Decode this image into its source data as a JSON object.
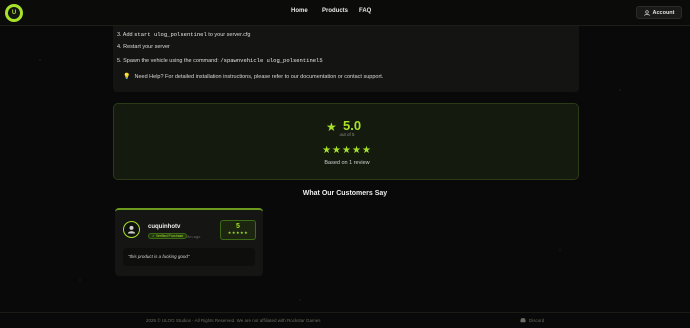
{
  "brand": {
    "logo_text": "U"
  },
  "nav": {
    "items": [
      "Home",
      "Products",
      "FAQ"
    ]
  },
  "account": {
    "label": "Account",
    "icon": "user-icon"
  },
  "install": {
    "step3_prefix": "3. Add",
    "step3_code": "start ulog_polsentinel",
    "step3_suffix": "to your server.cfg",
    "step4": "4. Restart your server",
    "step5_prefix": "5. Spawn the vehicle using the command:",
    "step5_code": "/spawnvehicle ulog_polsentinel5",
    "help_text": "Need Help? For detailed installation instructions, please refer to our documentation or contact support."
  },
  "rating": {
    "score": "5.0",
    "out_of": "out of 5",
    "stars": "★★★★★",
    "based_on": "Based on 1 review"
  },
  "reviews": {
    "title": "What Our Customers Say",
    "items": [
      {
        "username": "cuquinhotv",
        "badge": "✓ Verified Purchase",
        "time": "5m ago",
        "score": "5",
        "stars": "★★★★★",
        "text": "\"this product is a fucking good\""
      }
    ]
  },
  "footer": {
    "copyright": "2025 © ULOG Studios - All Rights Reserved. We are not affiliated with Rockstar Games",
    "discord": "Discord"
  },
  "colors": {
    "accent": "#a7e12a",
    "background": "#080908",
    "panel": "#141513"
  }
}
